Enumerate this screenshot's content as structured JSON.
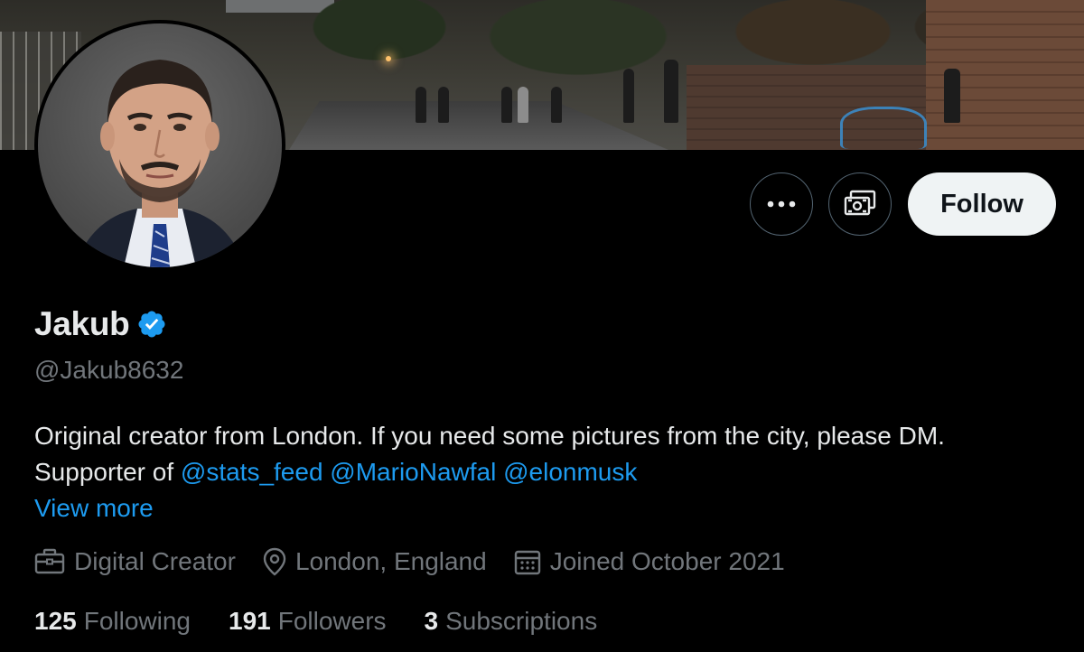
{
  "profile": {
    "display_name": "Jakub",
    "verified": true,
    "handle": "@Jakub8632",
    "bio_text": "Original creator from London. If you need some pictures from the city, please DM.",
    "bio_prefix": "Supporter of",
    "mentions": [
      "@stats_feed",
      "@MarioNawfal",
      "@elonmusk"
    ],
    "view_more": "View more",
    "category": "Digital Creator",
    "location": "London, England",
    "joined": "Joined October 2021"
  },
  "actions": {
    "more_icon": "more-horizontal-icon",
    "subscribe_icon": "subscription-money-icon",
    "follow_label": "Follow"
  },
  "stats": {
    "following_count": "125",
    "following_label": "Following",
    "followers_count": "191",
    "followers_label": "Followers",
    "subscriptions_count": "3",
    "subscriptions_label": "Subscriptions"
  },
  "colors": {
    "background": "#000000",
    "accent": "#1d9bf0",
    "muted_text": "#71767b",
    "primary_text": "#e7e9ea",
    "follow_button_bg": "#eff3f4"
  }
}
